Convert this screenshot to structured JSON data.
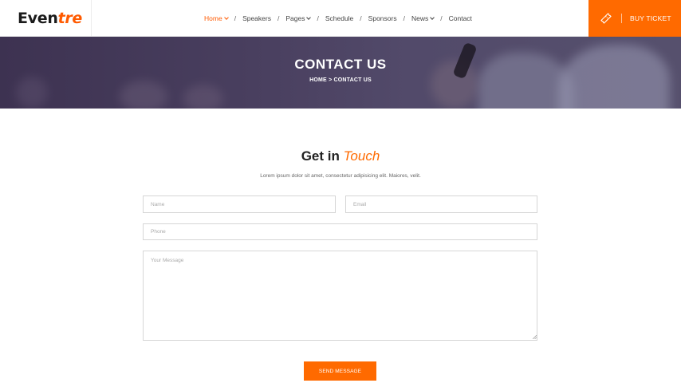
{
  "brand": {
    "logo_main": "Even",
    "logo_accent": "tre",
    "accent_color": "#ff6a00"
  },
  "nav": {
    "items": [
      {
        "label": "Home",
        "active": true,
        "dropdown": true
      },
      {
        "label": "Speakers",
        "active": false,
        "dropdown": false
      },
      {
        "label": "Pages",
        "active": false,
        "dropdown": true
      },
      {
        "label": "Schedule",
        "active": false,
        "dropdown": false
      },
      {
        "label": "Sponsors",
        "active": false,
        "dropdown": false
      },
      {
        "label": "News",
        "active": false,
        "dropdown": true
      },
      {
        "label": "Contact",
        "active": false,
        "dropdown": false
      }
    ],
    "separator": "/"
  },
  "cta": {
    "label": "BUY TICKET",
    "icon": "ticket-icon"
  },
  "banner": {
    "title": "CONTACT US",
    "breadcrumb_home": "HOME",
    "breadcrumb_sep": ">",
    "breadcrumb_current": "CONTACT US"
  },
  "contact": {
    "title_plain": "Get in",
    "title_accent": "Touch",
    "subtitle": "Lorem ipsum dolor sit amet, consectetur adipisicing elit. Maiores, velit.",
    "fields": {
      "name_placeholder": "Name",
      "email_placeholder": "Email",
      "phone_placeholder": "Phone",
      "message_placeholder": "Your Message"
    },
    "submit_label": "SEND MESSAGE"
  }
}
